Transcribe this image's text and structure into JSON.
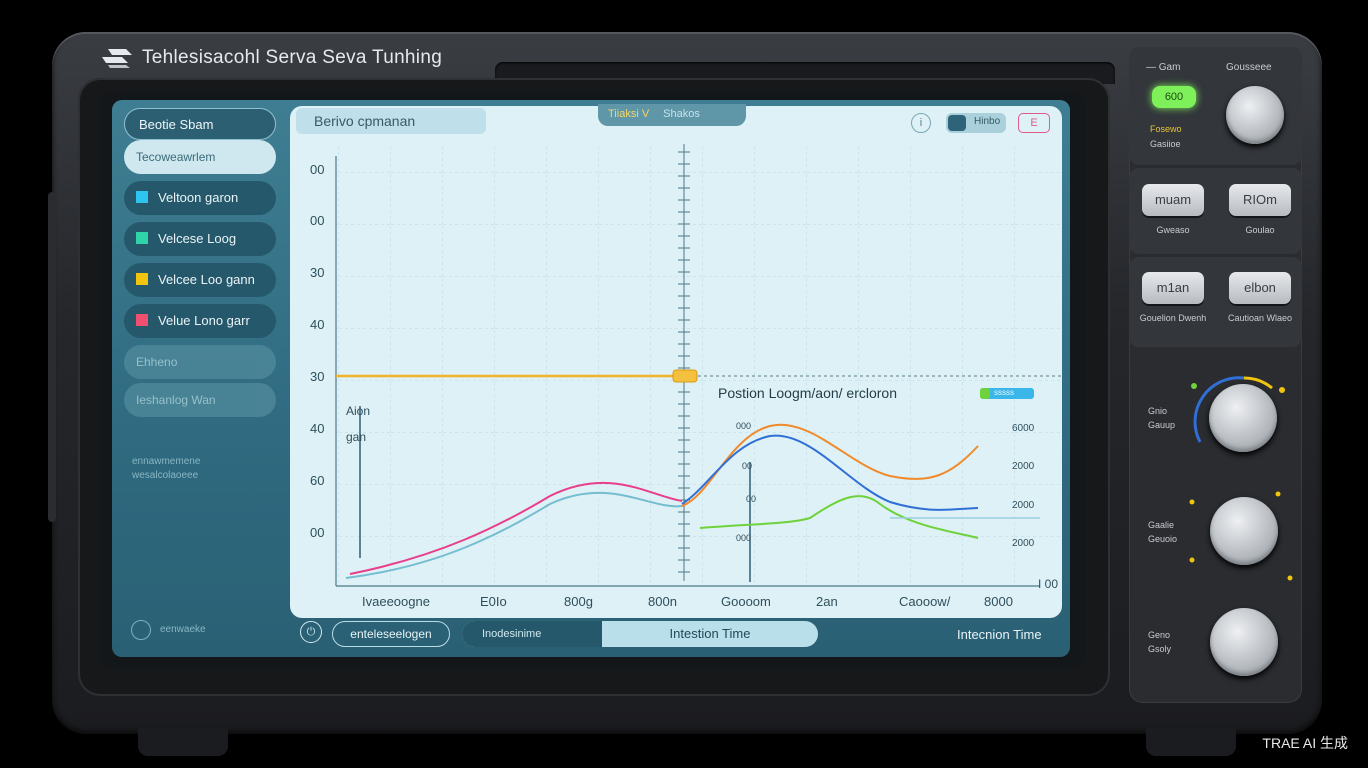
{
  "app": {
    "title": "Tehlesisacohl Serva Seva Tunhing",
    "watermark": "TRAE AI 生成"
  },
  "sidebar": {
    "title": "Beotie Sbam",
    "active": "Tecoweawrlem",
    "items": [
      {
        "label": "Veltoon garon",
        "color": "#2fc4f0"
      },
      {
        "label": "Velcese Loog",
        "color": "#2fd4a8"
      },
      {
        "label": "Velcee Loo gann",
        "color": "#f1c40f"
      },
      {
        "label": "Velue Lono garr",
        "color": "#f0506e"
      }
    ],
    "dim_items": [
      "Ehheno",
      "Ieshanlog Wan"
    ],
    "notes": [
      "ennawmemene",
      "wesalcolaoeee",
      "eenwaeke"
    ]
  },
  "plot": {
    "title": "Berivo  cpmanan",
    "tab_left": "Tiiaksi",
    "tab_marker": "V",
    "tab_right": "Shakos",
    "toggle_label": "Hinbo",
    "icon_left": "i",
    "icon_right": "E",
    "y_ticks": [
      "00",
      "00",
      "30",
      "40",
      "30",
      "40",
      "60",
      "00"
    ],
    "x_ticks": [
      "Ivaeeoogne",
      "E0Io",
      "800g",
      "800n",
      "Goooom",
      "2an",
      "Caooow/",
      "8000"
    ],
    "x_end": "I 00",
    "y_axis_label_1": "Aion",
    "y_axis_label_2": "gan",
    "inset_title": "Postion Loogm/aon/ ercloron",
    "inset_badge": "sssss",
    "inset_y": [
      "000",
      "00",
      "00",
      "000"
    ],
    "right_ticks": [
      "6000",
      "2000",
      "2000",
      "2000"
    ],
    "colors": {
      "blue": "#2f6fd6",
      "orange": "#f08a2a",
      "green": "#6ed23a",
      "pink": "#e83e8c",
      "yellow": "#f0b429",
      "teal": "#5ab0c7"
    }
  },
  "bottom": {
    "left_icon": "power-icon",
    "btn1": "enteleseelogen",
    "seg_left": "Inodesinime",
    "seg_right": "Intestion Time",
    "right_label": "Intecnion Time"
  },
  "right_panel": {
    "top_left": "Gam",
    "top_right": "Gousseee",
    "led_label": "600",
    "led_caption_1": "Fosewo",
    "led_caption_2": "Gasiioe",
    "buttons": [
      {
        "label": "muam",
        "caption": "Gweaso"
      },
      {
        "label": "RIOm",
        "caption": "Goulao"
      },
      {
        "label": "m1an",
        "caption": "Gouelion Dwenh"
      },
      {
        "label": "elbon",
        "caption": "Cautioan Wlaeo"
      }
    ],
    "knobs": [
      {
        "label1": "Gnio",
        "label2": "Gauup"
      },
      {
        "label1": "Gaalie",
        "label2": "Geuoio"
      },
      {
        "label1": "Geno",
        "label2": "Gsoly"
      }
    ]
  }
}
